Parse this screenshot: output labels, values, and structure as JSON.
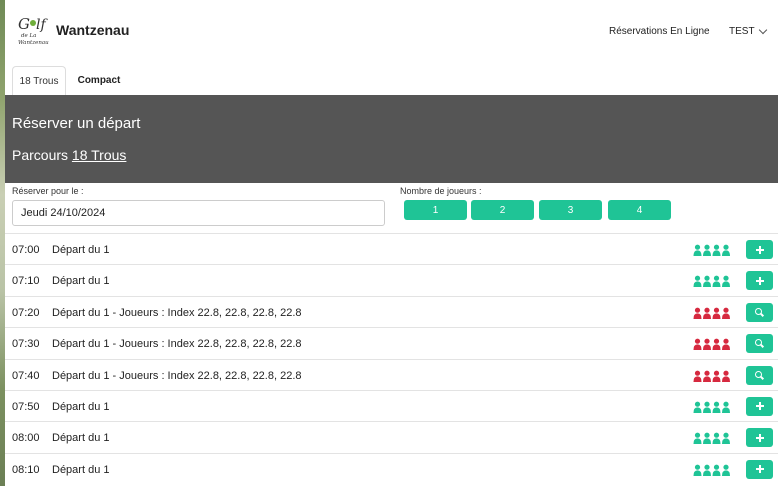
{
  "brand": {
    "logo_text": "Golf de La Wantzenau",
    "name": "Wantzenau"
  },
  "nav": {
    "reservations_label": "Réservations En Ligne",
    "user_label": "TEST"
  },
  "tabs": [
    {
      "label": "18 Trous"
    },
    {
      "label": "Compact"
    }
  ],
  "hero": {
    "title": "Réserver un départ",
    "course_prefix": "Parcours",
    "course_name": "18 Trous"
  },
  "form": {
    "date_label": "Réserver pour le :",
    "date_value": "Jeudi 24/10/2024",
    "players_label": "Nombre de joueurs :",
    "player_options": [
      "1",
      "2",
      "3",
      "4"
    ]
  },
  "colors": {
    "accent": "#1fc496",
    "booked": "#d6293f",
    "hero_bg": "#555555"
  },
  "tee_times": [
    {
      "time": "07:00",
      "description": "Départ du 1",
      "status": "available",
      "action_icon": "plus-icon"
    },
    {
      "time": "07:10",
      "description": "Départ du 1",
      "status": "available",
      "action_icon": "plus-icon"
    },
    {
      "time": "07:20",
      "description": "Départ du 1 - Joueurs : Index 22.8, 22.8, 22.8, 22.8",
      "status": "full",
      "action_icon": "search-icon"
    },
    {
      "time": "07:30",
      "description": "Départ du 1 - Joueurs : Index 22.8, 22.8, 22.8, 22.8",
      "status": "full",
      "action_icon": "search-icon"
    },
    {
      "time": "07:40",
      "description": "Départ du 1 - Joueurs : Index 22.8, 22.8, 22.8, 22.8",
      "status": "full",
      "action_icon": "search-icon"
    },
    {
      "time": "07:50",
      "description": "Départ du 1",
      "status": "available",
      "action_icon": "plus-icon"
    },
    {
      "time": "08:00",
      "description": "Départ du 1",
      "status": "available",
      "action_icon": "plus-icon"
    },
    {
      "time": "08:10",
      "description": "Départ du 1",
      "status": "available",
      "action_icon": "plus-icon"
    }
  ]
}
